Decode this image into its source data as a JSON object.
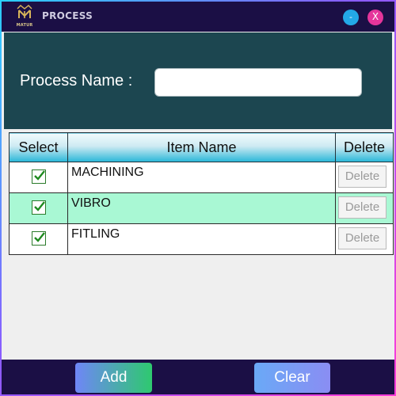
{
  "window": {
    "title": "PROCESS",
    "logo_text": "MATUR",
    "minimize_label": "-",
    "close_label": "X"
  },
  "form": {
    "process_name_label": "Process Name :",
    "process_name_value": "",
    "process_name_placeholder": ""
  },
  "grid": {
    "columns": [
      "Select",
      "Item Name",
      "Delete"
    ],
    "rows": [
      {
        "selected": true,
        "name": "MACHINING",
        "delete_label": "Delete"
      },
      {
        "selected": true,
        "name": "VIBRO",
        "delete_label": "Delete"
      },
      {
        "selected": true,
        "name": "FITLING",
        "delete_label": "Delete"
      }
    ],
    "alt_row_color": "#a9f8d4",
    "header_accent": "#28b7d8"
  },
  "footer": {
    "add_label": "Add",
    "clear_label": "Clear"
  },
  "colors": {
    "titlebar": "#1b0f45",
    "header_panel": "#1c4650",
    "minimize": "#23a9e8",
    "close": "#e5359b"
  },
  "icons": {
    "logo": "matur-crown-logo-icon",
    "checkbox": "checkbox-checked-icon"
  }
}
